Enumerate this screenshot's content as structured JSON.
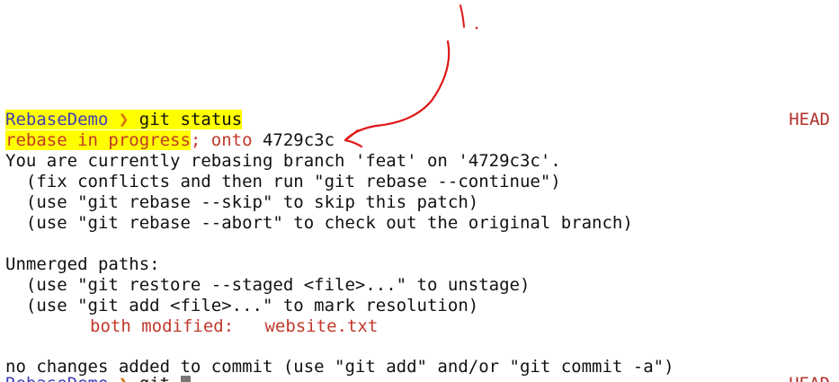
{
  "prompt": {
    "dir": "RebaseDemo",
    "arrow": "❯",
    "command": "git status",
    "head_label": "HEAD"
  },
  "status_line": {
    "rebase_text": "rebase in progress",
    "rest": "; onto ",
    "commit": "4729c3c"
  },
  "lines": [
    "You are currently rebasing branch 'feat' on '4729c3c'.",
    "  (fix conflicts and then run \"git rebase --continue\")",
    "  (use \"git rebase --skip\" to skip this patch)",
    "  (use \"git rebase --abort\" to check out the original branch)",
    "",
    "Unmerged paths:",
    "  (use \"git restore --staged <file>...\" to unstage)",
    "  (use \"git add <file>...\" to mark resolution)"
  ],
  "unmerged_file": {
    "status": "both modified:",
    "name": "website.txt"
  },
  "footer": "no changes added to commit (use \"git add\" and/or \"git commit -a\")",
  "next_prompt": {
    "dir": "RebaseDemo",
    "arrow": "❯",
    "partial": "git",
    "head_label": "HEAD"
  },
  "colors": {
    "highlight": "#ffff00",
    "annotation": "#e01818",
    "prompt_dir": "#3f3fb6",
    "error_red": "#c0392b"
  }
}
